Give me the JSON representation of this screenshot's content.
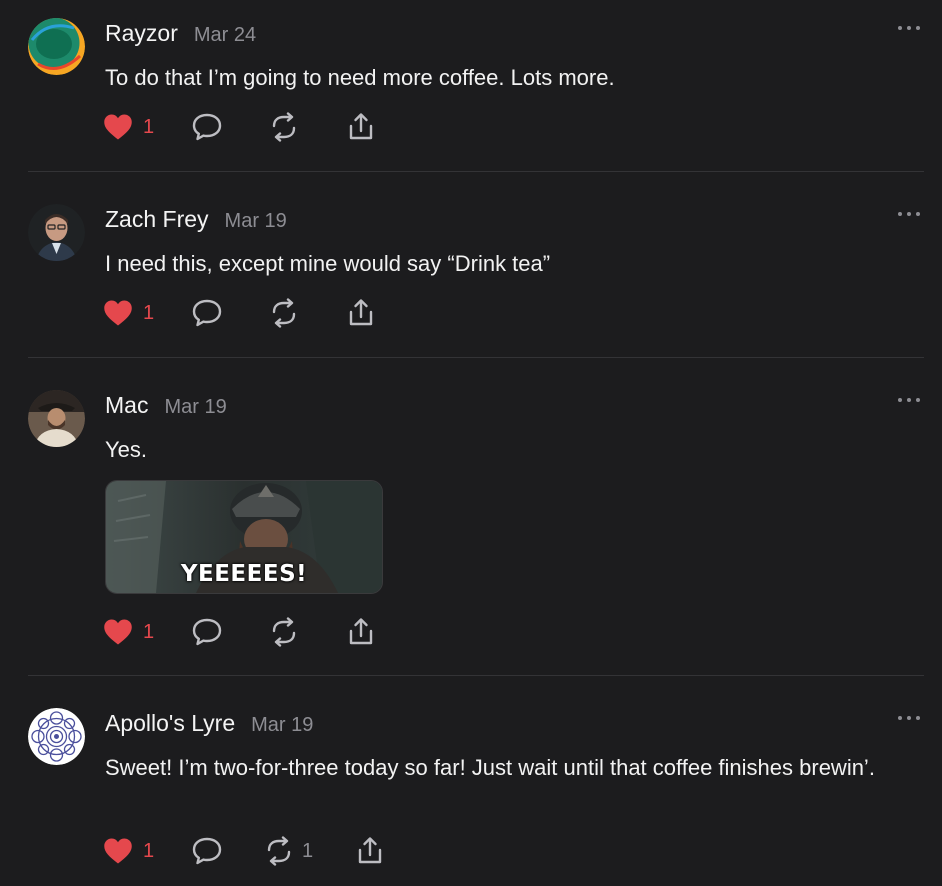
{
  "posts": [
    {
      "author": "Rayzor",
      "date": "Mar 24",
      "text": "To do that I’m going to need more coffee. Lots more.",
      "likes": "1",
      "reposts": ""
    },
    {
      "author": "Zach Frey",
      "date": "Mar 19",
      "text": "I need this, except mine would say “Drink tea”",
      "likes": "1",
      "reposts": ""
    },
    {
      "author": "Mac",
      "date": "Mar 19",
      "text": "Yes.",
      "gif_caption": "YEEEEES!",
      "likes": "1",
      "reposts": ""
    },
    {
      "author": "Apollo's Lyre",
      "date": "Mar 19",
      "text": "Sweet! I’m two-for-three today so far! Just wait until that coffee finishes brewin’.",
      "likes": "1",
      "reposts": "1"
    }
  ],
  "icons": {
    "like": "heart-icon",
    "reply": "speech-bubble-icon",
    "repost": "repost-arrows-icon",
    "share": "share-upload-icon",
    "more": "ellipsis-icon"
  },
  "colors": {
    "background": "#1c1c1e",
    "like": "#e5484d",
    "muted": "#8d8d93",
    "text": "#f2f2f2",
    "divider": "#333336"
  }
}
